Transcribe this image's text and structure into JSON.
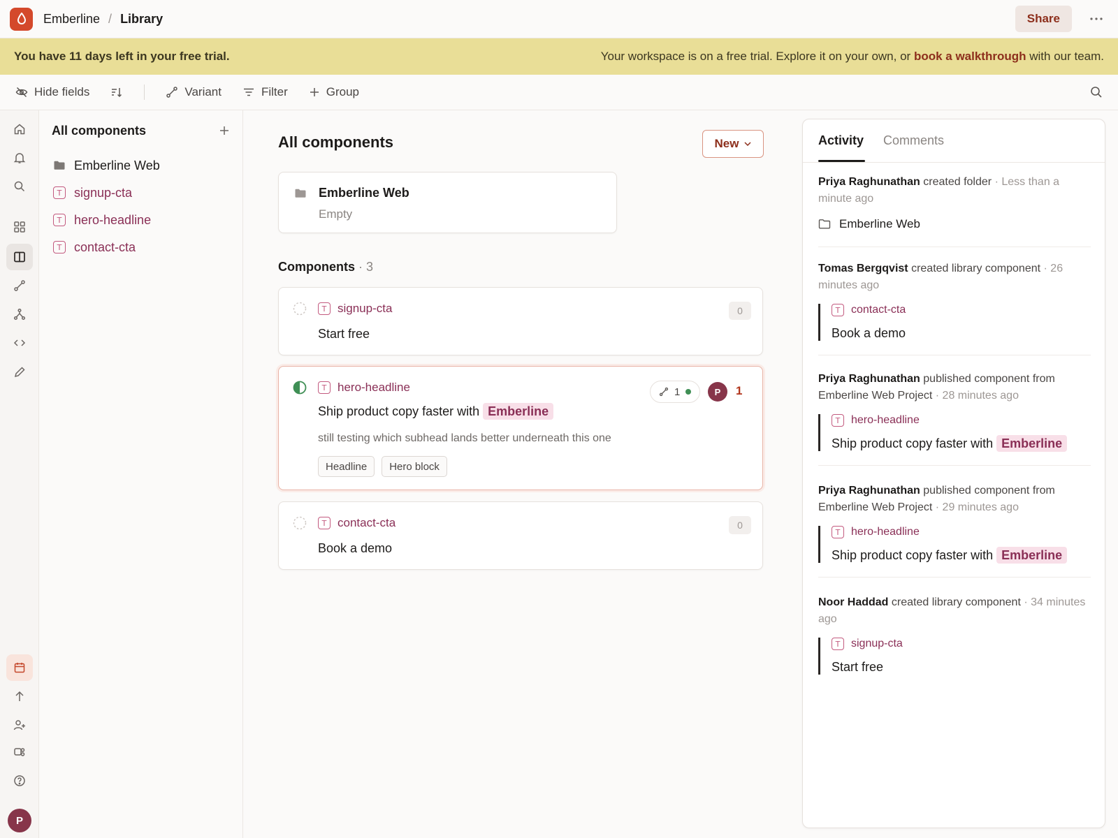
{
  "topbar": {
    "workspace": "Emberline",
    "separator": "/",
    "current": "Library",
    "share_label": "Share"
  },
  "banner": {
    "lead": "You have 11 days left in your free trial.",
    "message_prefix": "Your workspace is on a free trial. Explore it on your own, or",
    "link": "book a walkthrough",
    "message_suffix": "with our team."
  },
  "toolbar": {
    "hide_fields": "Hide fields",
    "variant": "Variant",
    "filter": "Filter",
    "group": "Group"
  },
  "tree": {
    "title": "All components",
    "folder": "Emberline Web",
    "items": [
      {
        "key": "signup-cta"
      },
      {
        "key": "hero-headline"
      },
      {
        "key": "contact-cta"
      }
    ]
  },
  "main": {
    "title": "All components",
    "new_label": "New",
    "folder_card": {
      "name": "Emberline Web",
      "sub": "Empty"
    },
    "components_label": "Components",
    "components_count": "· 3",
    "cards": [
      {
        "key": "signup-cta",
        "text": "Start free",
        "count": "0"
      },
      {
        "key": "hero-headline",
        "text_prefix": "Ship product copy faster with",
        "highlight": "Emberline",
        "note": "still testing which subhead lands better underneath this one",
        "tags": [
          "Headline",
          "Hero block"
        ],
        "variants": "1",
        "avatar": "P",
        "comments": "1"
      },
      {
        "key": "contact-cta",
        "text": "Book a demo",
        "count": "0"
      }
    ]
  },
  "panel": {
    "tabs": [
      "Activity",
      "Comments"
    ],
    "activities": [
      {
        "user": "Priya Raghunathan",
        "action": "created folder",
        "meta": "· Less than a minute ago",
        "object": "Emberline Web"
      },
      {
        "user": "Tomas Bergqvist",
        "action": "created library component",
        "meta": "· 26 minutes ago",
        "key": "contact-cta",
        "text": "Book a demo"
      },
      {
        "user": "Priya Raghunathan",
        "action": "published component from Emberline Web Project",
        "meta": "· 28 minutes ago",
        "key": "hero-headline",
        "text_prefix": "Ship product copy faster with",
        "highlight": "Emberline"
      },
      {
        "user": "Priya Raghunathan",
        "action": "published component from Emberline Web Project",
        "meta": "· 29 minutes ago",
        "key": "hero-headline",
        "text_prefix": "Ship product copy faster with",
        "highlight": "Emberline"
      },
      {
        "user": "Noor Haddad",
        "action": "created library component",
        "meta": "· 34 minutes ago",
        "key": "signup-cta",
        "text": "Start free"
      }
    ]
  },
  "user": {
    "avatar": "P"
  },
  "colors": {
    "accent": "#d4492b",
    "brand_text": "#8d2f1c",
    "component": "#8a2f56",
    "banner": "#e9de97"
  }
}
